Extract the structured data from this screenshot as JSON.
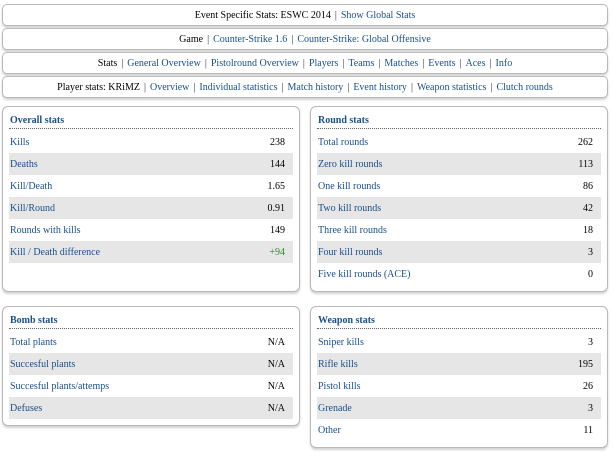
{
  "header": {
    "event_label": "Event Specific Stats: ESWC 2014",
    "show_global": "Show Global Stats"
  },
  "game_bar": {
    "label": "Game",
    "options": [
      "Counter-Strike 1.6",
      "Counter-Strike: Global Offensive"
    ]
  },
  "stats_bar": {
    "label": "Stats",
    "links": [
      "General Overview",
      "Pistolround Overview",
      "Players",
      "Teams",
      "Matches",
      "Events",
      "Aces",
      "Info"
    ]
  },
  "player_bar": {
    "label": "Player stats: KRiMZ",
    "links": [
      "Overview",
      "Individual statistics",
      "Match history",
      "Event history",
      "Weapon statistics",
      "Clutch rounds"
    ]
  },
  "overall_stats": {
    "title": "Overall stats",
    "rows": [
      {
        "label": "Kills",
        "value": "238"
      },
      {
        "label": "Deaths",
        "value": "144"
      },
      {
        "label": "Kill/Death",
        "value": "1.65"
      },
      {
        "label": "Kill/Round",
        "value": "0.91"
      },
      {
        "label": "Rounds with kills",
        "value": "149"
      },
      {
        "label": "Kill / Death difference",
        "value": "+94"
      }
    ]
  },
  "round_stats": {
    "title": "Round stats",
    "rows": [
      {
        "label": "Total rounds",
        "value": "262"
      },
      {
        "label": "Zero kill rounds",
        "value": "113"
      },
      {
        "label": "One kill rounds",
        "value": "86"
      },
      {
        "label": "Two kill rounds",
        "value": "42"
      },
      {
        "label": "Three kill rounds",
        "value": "18"
      },
      {
        "label": "Four kill rounds",
        "value": "3"
      },
      {
        "label": "Five kill rounds (ACE)",
        "value": "0"
      }
    ]
  },
  "bomb_stats": {
    "title": "Bomb stats",
    "rows": [
      {
        "label": "Total plants",
        "value": "N/A"
      },
      {
        "label": "Succesful plants",
        "value": "N/A"
      },
      {
        "label": "Succesful plants/attemps",
        "value": "N/A"
      },
      {
        "label": "Defuses",
        "value": "N/A"
      }
    ]
  },
  "weapon_stats": {
    "title": "Weapon stats",
    "rows": [
      {
        "label": "Sniper kills",
        "value": "3"
      },
      {
        "label": "Rifle kills",
        "value": "195"
      },
      {
        "label": "Pistol kills",
        "value": "26"
      },
      {
        "label": "Grenade",
        "value": "3"
      },
      {
        "label": "Other",
        "value": "11"
      }
    ]
  },
  "colors": {
    "link": "#1a4f8a",
    "alt_row": "#e6e6e6",
    "positive": "#2e8b2e",
    "border": "#b9b9b9"
  }
}
